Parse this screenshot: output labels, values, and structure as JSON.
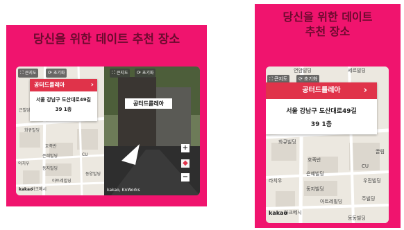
{
  "title": "당신을 위한 데이트 추천 장소",
  "title_line1": "당신을 위한 데이트",
  "title_line2": "추천 장소",
  "controls": {
    "map_label": "큰지도",
    "reset_label": "초기화"
  },
  "place": {
    "name": "공터드를레아",
    "address": "서울 강남구 도산대로49길",
    "floor": "39 1층",
    "chevron": "›"
  },
  "roadview": {
    "place_label": "공터드를레아",
    "brand": "kakao, KnWorks"
  },
  "map": {
    "logo": "kakao",
    "labels_left": [
      "화큐빌딩",
      "호족반",
      "은혜빌딩",
      "동지빌딩",
      "아트레빌딩",
      "아크메시",
      "와치우",
      "CU",
      "동양빌딩",
      "근빌딩"
    ],
    "labels_right": [
      "연암빌딩",
      "세르빌딩",
      "화큐빌딩",
      "호족반",
      "은혜빌딩",
      "동지빌딩",
      "아트레빌딩",
      "아크메시",
      "끌림",
      "CU",
      "라치우",
      "우진빌딩",
      "동동빌딩",
      "주빌딩"
    ]
  },
  "colors": {
    "panel": "#f0146e",
    "title": "#6b0a2e",
    "card_header": "#e0334a"
  },
  "icons": {
    "map": "expand-icon",
    "reset": "refresh-icon",
    "zoom_in": "plus-icon",
    "zoom_out": "minus-icon",
    "compass": "compass-icon",
    "direction": "arrow-icon"
  }
}
